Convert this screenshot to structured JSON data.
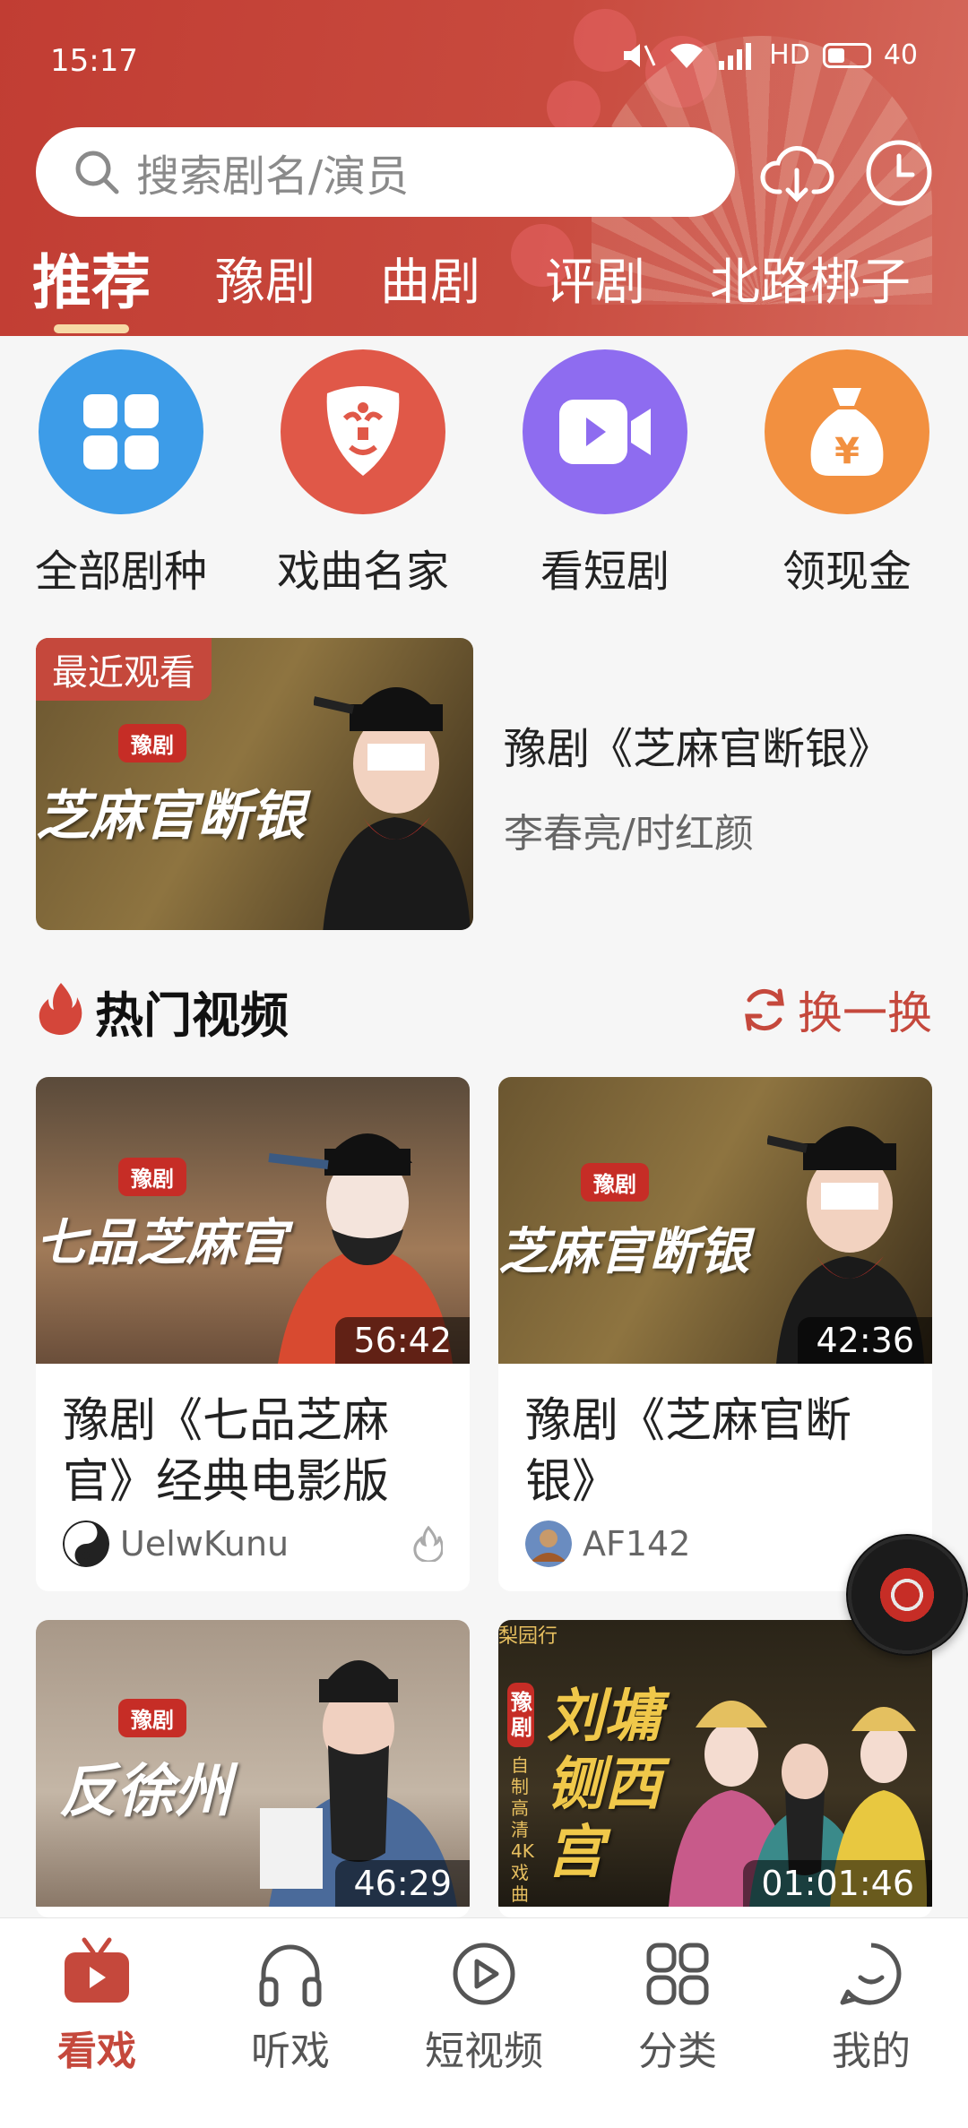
{
  "status_bar": {
    "time": "15:17",
    "network": "HD",
    "battery": "40"
  },
  "search": {
    "placeholder": "搜索剧名/演员"
  },
  "header": {
    "download_icon": "cloud-download-icon",
    "history_icon": "clock-icon"
  },
  "tabs": [
    {
      "label": "推荐",
      "active": true
    },
    {
      "label": "豫剧"
    },
    {
      "label": "曲剧"
    },
    {
      "label": "评剧"
    },
    {
      "label": "北路梆子"
    }
  ],
  "shortcuts": [
    {
      "label": "全部剧种",
      "icon": "grid-icon",
      "color": "#3d9ce8"
    },
    {
      "label": "戏曲名家",
      "icon": "opera-mask-icon",
      "color": "#e05848"
    },
    {
      "label": "看短剧",
      "icon": "video-camera-icon",
      "color": "#8e6cf0"
    },
    {
      "label": "领现金",
      "icon": "money-bag-icon",
      "color": "#f29040"
    }
  ],
  "recent": {
    "badge": "最近观看",
    "thumb_tag": "豫剧",
    "thumb_title": "芝麻官断银",
    "title": "豫剧《芝麻官断银》",
    "subtitle": "李春亮/时红颜"
  },
  "hot": {
    "title": "热门视频",
    "refresh_label": "换一换",
    "videos": [
      {
        "thumb_tag": "豫剧",
        "thumb_title": "七品芝麻官",
        "duration": "56:42",
        "title": "豫剧《七品芝麻官》经典电影版",
        "author": "UelwKunu"
      },
      {
        "thumb_tag": "豫剧",
        "thumb_title": "芝麻官断银",
        "duration": "42:36",
        "title": "豫剧《芝麻官断银》",
        "author": "AF142"
      },
      {
        "thumb_tag": "豫剧",
        "thumb_title": "反徐州",
        "duration": "46:29"
      },
      {
        "thumb_tag": "豫剧",
        "thumb_title": "刘墉铡西宫",
        "thumb_side": "自制高清4K戏曲",
        "thumb_brand": "梨园行",
        "duration": "01:01:46"
      }
    ]
  },
  "bottom_nav": [
    {
      "label": "看戏",
      "icon": "tv-icon",
      "active": true
    },
    {
      "label": "听戏",
      "icon": "headphones-icon"
    },
    {
      "label": "短视频",
      "icon": "play-circle-icon"
    },
    {
      "label": "分类",
      "icon": "category-icon"
    },
    {
      "label": "我的",
      "icon": "profile-icon"
    }
  ],
  "colors": {
    "brand_red": "#c5483c",
    "header_bg": "#c13d33",
    "tab_underline": "#f7d9a6"
  }
}
